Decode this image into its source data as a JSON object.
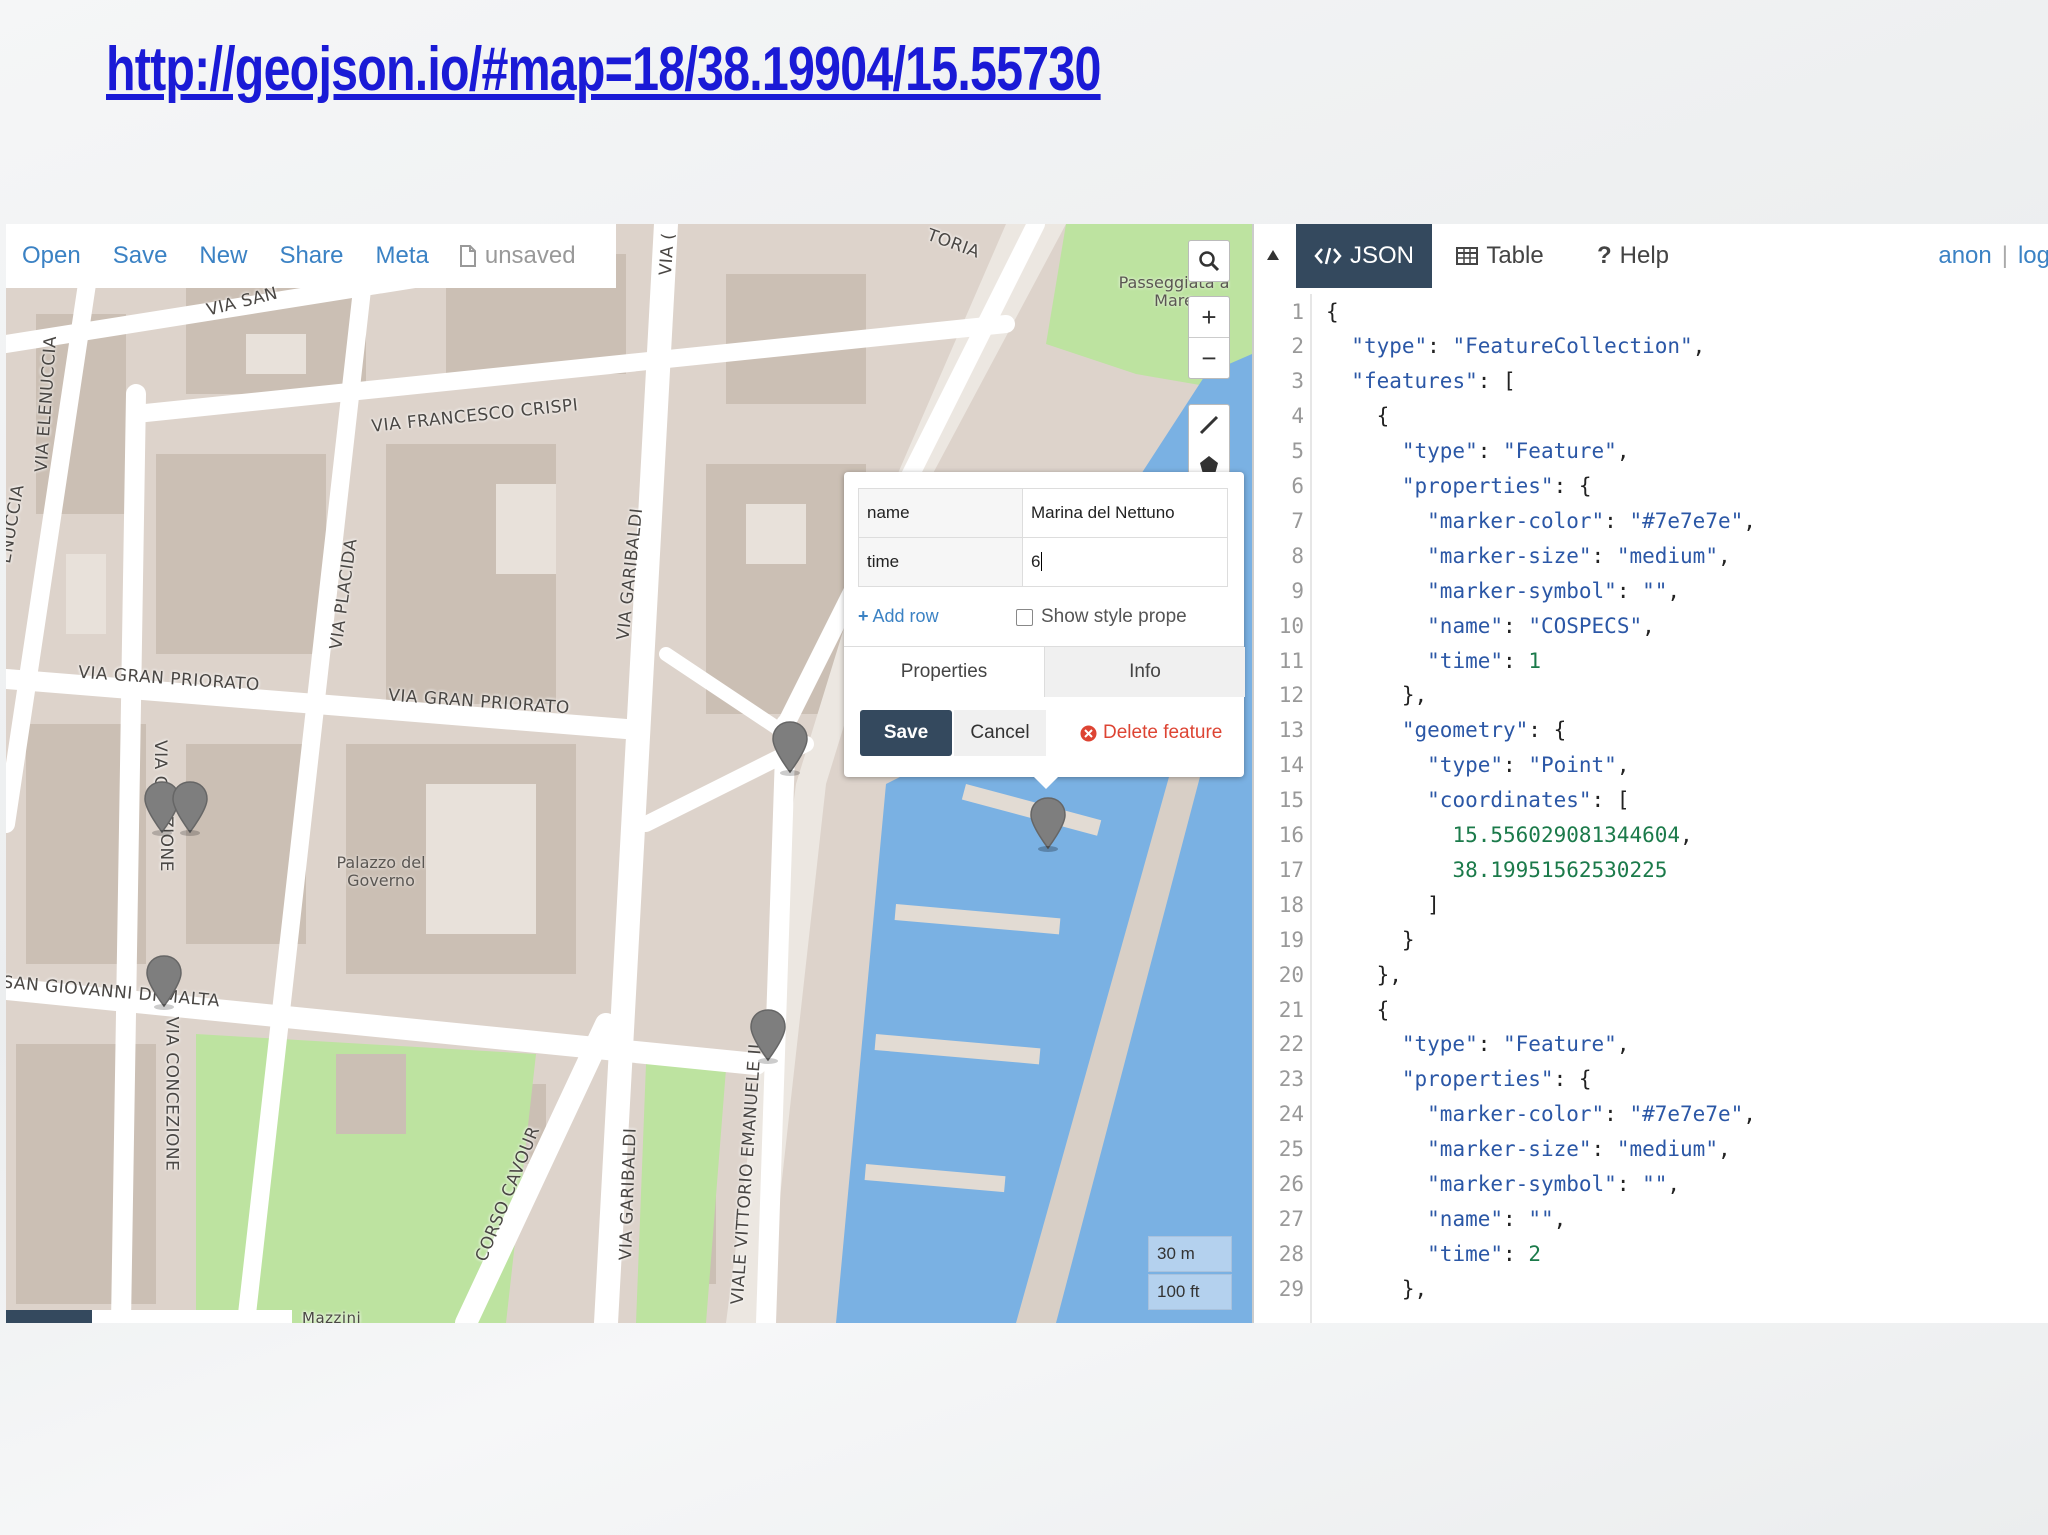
{
  "url_title": "http://geojson.io/#map=18/38.19904/15.55730",
  "menu": {
    "open": "Open",
    "save": "Save",
    "new": "New",
    "share": "Share",
    "meta": "Meta",
    "unsaved": "unsaved"
  },
  "map": {
    "streets": {
      "via_san": "VIA SAN",
      "via_elenuccia": "VIA ELENUCCIA",
      "enuccia": "ENUCCIA",
      "via_francesco_crispi": "VIA FRANCESCO CRISPI",
      "via_gran_priorato_1": "VIA GRAN PRIORATO",
      "via_gran_priorato_2": "VIA GRAN PRIORATO",
      "via_placida": "VIA PLACIDA",
      "via_garibaldi_1": "VIA GARIBALDI",
      "via_garibaldi_2": "VIA GARIBALDI",
      "via_top": "VIA (",
      "via_c": "VIA C",
      "zione": "ZIONE",
      "san_giovanni": "SAN GIOVANNI DI MALTA",
      "via_concezione": "VIA CONCEZIONE",
      "corso_cavour": "CORSO CAVOUR",
      "viale_vittorio": "VIALE VITTORIO EMANUELE II",
      "toria": "TORIA",
      "mazzini": "Mazzini"
    },
    "pois": {
      "palazzo": "Palazzo del Governo",
      "passeggiata": "Passeggiata a Mare"
    },
    "scale_m": "30 m",
    "scale_ft": "100 ft",
    "controls": {
      "search_icon": "search-icon",
      "zoom_in": "+",
      "zoom_out": "−"
    }
  },
  "popup": {
    "rows": [
      {
        "key": "name",
        "value": "Marina del Nettuno"
      },
      {
        "key": "time",
        "value": "6"
      }
    ],
    "add_row": "Add row",
    "show_style": "Show style prope",
    "tab_properties": "Properties",
    "tab_info": "Info",
    "save": "Save",
    "cancel": "Cancel",
    "delete": "Delete feature"
  },
  "panel": {
    "tab_json": "JSON",
    "tab_table": "Table",
    "tab_help": "Help",
    "user_anon": "anon",
    "user_sep": "|",
    "user_login": "log",
    "accent": "#34495e"
  },
  "code_lines": [
    {
      "n": "1",
      "t": "{"
    },
    {
      "n": "2",
      "t": "  \"type\": \"FeatureCollection\","
    },
    {
      "n": "3",
      "t": "  \"features\": ["
    },
    {
      "n": "4",
      "t": "    {"
    },
    {
      "n": "5",
      "t": "      \"type\": \"Feature\","
    },
    {
      "n": "6",
      "t": "      \"properties\": {"
    },
    {
      "n": "7",
      "t": "        \"marker-color\": \"#7e7e7e\","
    },
    {
      "n": "8",
      "t": "        \"marker-size\": \"medium\","
    },
    {
      "n": "9",
      "t": "        \"marker-symbol\": \"\","
    },
    {
      "n": "10",
      "t": "        \"name\": \"COSPECS\","
    },
    {
      "n": "11",
      "t": "        \"time\": 1"
    },
    {
      "n": "12",
      "t": "      },"
    },
    {
      "n": "13",
      "t": "      \"geometry\": {"
    },
    {
      "n": "14",
      "t": "        \"type\": \"Point\","
    },
    {
      "n": "15",
      "t": "        \"coordinates\": ["
    },
    {
      "n": "16",
      "t": "          15.556029081344604,"
    },
    {
      "n": "17",
      "t": "          38.19951562530225"
    },
    {
      "n": "18",
      "t": "        ]"
    },
    {
      "n": "19",
      "t": "      }"
    },
    {
      "n": "20",
      "t": "    },"
    },
    {
      "n": "21",
      "t": "    {"
    },
    {
      "n": "22",
      "t": "      \"type\": \"Feature\","
    },
    {
      "n": "23",
      "t": "      \"properties\": {"
    },
    {
      "n": "24",
      "t": "        \"marker-color\": \"#7e7e7e\","
    },
    {
      "n": "25",
      "t": "        \"marker-size\": \"medium\","
    },
    {
      "n": "26",
      "t": "        \"marker-symbol\": \"\","
    },
    {
      "n": "27",
      "t": "        \"name\": \"\","
    },
    {
      "n": "28",
      "t": "        \"time\": 2"
    },
    {
      "n": "29",
      "t": "      },"
    }
  ]
}
